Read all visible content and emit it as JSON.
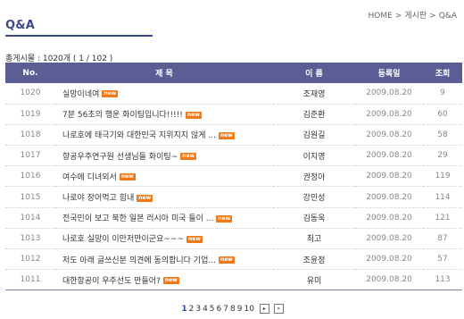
{
  "header": {
    "title": "Q&A"
  },
  "breadcrumb": {
    "items": [
      "HOME",
      "게시판",
      "Q&A"
    ],
    "separator": ">"
  },
  "summary": {
    "text": "총게시물 : 1020개 ( 1 / 102 )"
  },
  "table": {
    "headers": {
      "no": "No.",
      "subject": "제 목",
      "author": "이 름",
      "date": "등록일",
      "views": "조회"
    },
    "rows": [
      {
        "no": "1020",
        "subject": "실망이네여",
        "new": "new",
        "author": "조재영",
        "date": "2009.08.20",
        "views": "9"
      },
      {
        "no": "1019",
        "subject": "7분 56초의 행운 화이팅입니다!!!!!",
        "new": "new",
        "author": "김준환",
        "date": "2009.08.20",
        "views": "60"
      },
      {
        "no": "1018",
        "subject": "나로호에 태극기와 대한민국 지위지지 않게 ...",
        "new": "new",
        "author": "김원길",
        "date": "2009.08.20",
        "views": "58"
      },
      {
        "no": "1017",
        "subject": "항공우주연구원 선생님들 화이팅~",
        "new": "new",
        "author": "이지영",
        "date": "2009.08.20",
        "views": "29"
      },
      {
        "no": "1016",
        "subject": "여수에 디녀외서",
        "new": "new",
        "author": "권정아",
        "date": "2009.08.20",
        "views": "119"
      },
      {
        "no": "1015",
        "subject": "나로야 장어먹고 힘내",
        "new": "new",
        "author": "강민성",
        "date": "2009.08.20",
        "views": "114"
      },
      {
        "no": "1014",
        "subject": "전국민이 보고 북한 일본 러시아 미국 들이 ...",
        "new": "new",
        "author": "김동욱",
        "date": "2009.08.20",
        "views": "121"
      },
      {
        "no": "1013",
        "subject": "나로호 실망이 이만저만이군요~~~",
        "new": "new",
        "author": "최고",
        "date": "2009.08.20",
        "views": "87"
      },
      {
        "no": "1012",
        "subject": "저도 아래 글쓰신분 의견에 동의합니다 기업...",
        "new": "new",
        "author": "조윤정",
        "date": "2009.08.20",
        "views": "57"
      },
      {
        "no": "1011",
        "subject": "대한항공이 우주선도 만들어?",
        "new": "new",
        "author": "유미",
        "date": "2009.08.20",
        "views": "113"
      }
    ]
  },
  "pagination": {
    "pages": [
      "1",
      "2",
      "3",
      "4",
      "5",
      "6",
      "7",
      "8",
      "9",
      "10"
    ],
    "current": "1",
    "next_icon": "▸",
    "last_icon": "»"
  },
  "colors": {
    "header_bg": "#5a5e94",
    "title": "#3b4a86",
    "new_badge": "#f07a1a"
  }
}
